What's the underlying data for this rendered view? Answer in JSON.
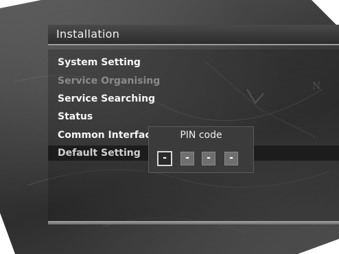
{
  "window": {
    "title": "Installation"
  },
  "menu": {
    "items": [
      {
        "label": "System Setting",
        "state": "normal"
      },
      {
        "label": "Service Organising",
        "state": "disabled"
      },
      {
        "label": "Service Searching",
        "state": "normal"
      },
      {
        "label": "Status",
        "state": "normal"
      },
      {
        "label": "Common Interfac",
        "state": "normal"
      },
      {
        "label": "Default Setting",
        "state": "selected"
      }
    ]
  },
  "pin_dialog": {
    "title": "PIN code",
    "digits": [
      "-",
      "-",
      "-",
      "-"
    ],
    "active_index": 0
  },
  "background_map_labels": [
    "N"
  ],
  "colors": {
    "text": "#f5f5f5",
    "disabled_text": "#8a8a8a",
    "selected_row": "#1c1c1c",
    "popup_bg": "#3b3b3b",
    "pin_box": "#6f6f6f"
  }
}
